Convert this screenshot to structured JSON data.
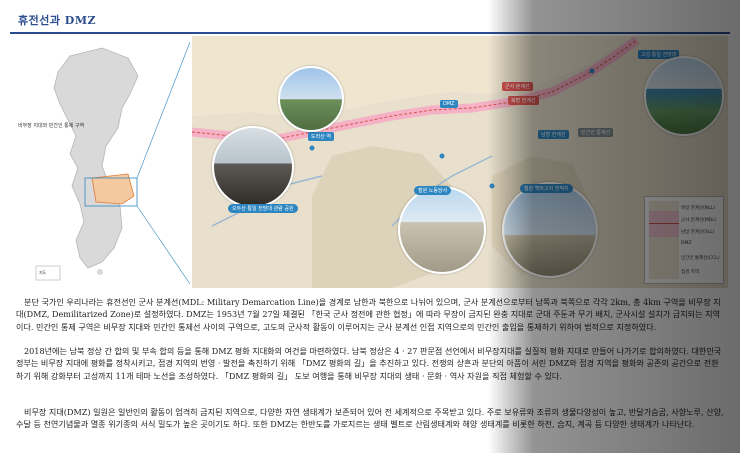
{
  "section_title": "휴전선과 DMZ",
  "inset_map": {
    "region_label": "비무장 지대와 민간인 통제 구역",
    "legend_small": "지도"
  },
  "map": {
    "callouts": [
      {
        "text": "고성 통일 전망대",
        "color": "blue"
      },
      {
        "text": "군사 분계선",
        "color": "red"
      },
      {
        "text": "북방 한계선",
        "color": "red"
      },
      {
        "text": "DMZ",
        "color": "blue"
      },
      {
        "text": "남방 한계선",
        "color": "blue"
      },
      {
        "text": "민간인 통제선",
        "color": "gray"
      },
      {
        "text": "도라산 역",
        "color": "blue"
      }
    ],
    "photo_captions": [
      "오두산 통일 전망대 관람 공원",
      "철원 노동당사",
      "철원 백마고지 전적지"
    ],
    "legend": {
      "rows": [
        "북방 한계선(NLL)",
        "군사 분계선(MDL)",
        "남방 한계선(SLL)",
        "DMZ",
        "민간인 통제선(CCL)",
        "접경 지역"
      ]
    }
  },
  "paragraphs": [
    "분단 국가인 우리나라는 휴전선인 군사 분계선(MDL: Military Demarcation Line)을 경계로 남한과 북한으로 나뉘어 있으며, 군사 분계선으로부터 남쪽과 북쪽으로 각각 2km, 총 4km 구역을 비무장 지대(DMZ, Demilitarized Zone)로 설정하였다. DMZ는 1953년 7월 27일 체결된 「한국 군사 정전에 관한 협정」에 따라 무장이 금지된 완충 지대로 군대 주둔과 무기 배치, 군사시설 설치가 금지되는 지역이다. 민간인 통제 구역은 비무장 지대와 민간인 통제선 사이의 구역으로, 고도의 군사적 활동이 이루어지는 군사 분계선 인접 지역으로의 민간인 출입을 통제하기 위하여 법적으로 지정하였다.",
    "2018년에는 남북 정상 간 합의 및 부속 합의 등을 통해 DMZ 평화 지대화의 여건을 마련하였다. 남북 정상은 4 · 27 판문점 선언에서 비무장지대를 실질적 평화 지대로 만들어 나가기로 합의하였다. 대한민국 정부는 비무장 지대에 평화를 정착시키고, 접경 지역의 번영 · 발전을 촉진하기 위해 「DMZ 평화의 길」을 추진하고 있다. 전쟁의 상흔과 분단의 아픔이 서린 DMZ와 접경 지역을 평화와 공존의 공간으로 전환하기 위해 강화부터 고성까지 11개 테마 노선을 조성하였다. 「DMZ 평화의 길」 도보 여행을 통해 비무장 지대의 생태 · 문화 · 역사 자원을 직접 체험할 수 있다.",
    "비무장 지대(DMZ) 일원은 일반인의 활동이 엄격히 금지된 지역으로, 다양한 자연 생태계가 보존되어 있어 전 세계적으로 주목받고 있다. 주로 보유류와 조류의 생물다양성이 높고, 반달가슴곰, 사향노루, 산양, 수달 등 천연기념물과 멸종 위기종의 서식 밀도가 높은 곳이기도 하다. 또한 DMZ는 한반도를 가로지르는 생태 벨트로 산림생태계와 해양 생태계를 비롯한 하천, 습지, 계곡 등 다양한 생태계가 나타난다."
  ]
}
